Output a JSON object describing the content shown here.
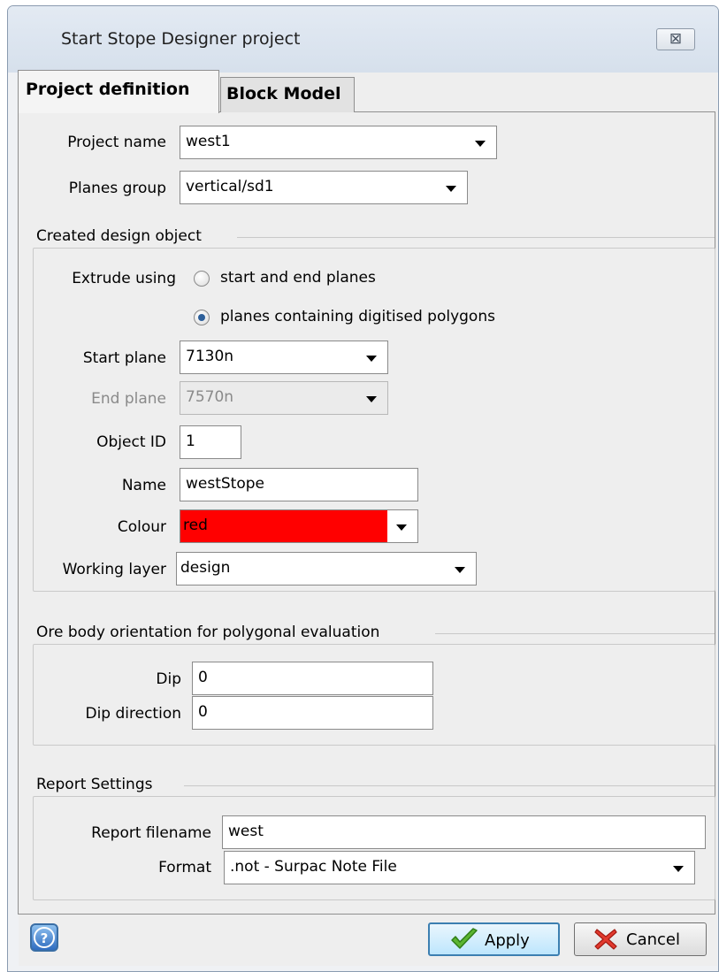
{
  "window": {
    "title": "Start Stope Designer project",
    "close_glyph": "⊠"
  },
  "tabs": [
    {
      "label": "Project definition",
      "active": true
    },
    {
      "label": "Block Model",
      "active": false
    }
  ],
  "project": {
    "name_label": "Project name",
    "name_value": "west1",
    "planes_label": "Planes group",
    "planes_value": "vertical/sd1"
  },
  "design_object": {
    "heading": "Created design object",
    "extrude_label": "Extrude using",
    "radio_start_end": "start and end planes",
    "radio_polygons": "planes containing digitised polygons",
    "selected_radio": "planes containing digitised polygons",
    "start_plane_label": "Start plane",
    "start_plane_value": "7130n",
    "end_plane_label": "End plane",
    "end_plane_value": "7570n",
    "object_id_label": "Object ID",
    "object_id_value": "1",
    "name_label": "Name",
    "name_value": "westStope",
    "colour_label": "Colour",
    "colour_value": "red",
    "colour_hex": "#ff0000",
    "layer_label": "Working layer",
    "layer_value": "design"
  },
  "orientation": {
    "heading": "Ore body orientation for polygonal evaluation",
    "dip_label": "Dip",
    "dip_value": "0",
    "dip_dir_label": "Dip direction",
    "dip_dir_value": "0"
  },
  "report": {
    "heading": "Report Settings",
    "filename_label": "Report filename",
    "filename_value": "west",
    "format_label": "Format",
    "format_value": ".not - Surpac Note File"
  },
  "buttons": {
    "apply": "Apply",
    "cancel": "Cancel",
    "help_icon": "help-icon",
    "apply_icon": "checkmark-icon",
    "cancel_icon": "x-icon"
  },
  "colors": {
    "accent": "#3c7fb1",
    "selected_colour": "#ff0000"
  }
}
